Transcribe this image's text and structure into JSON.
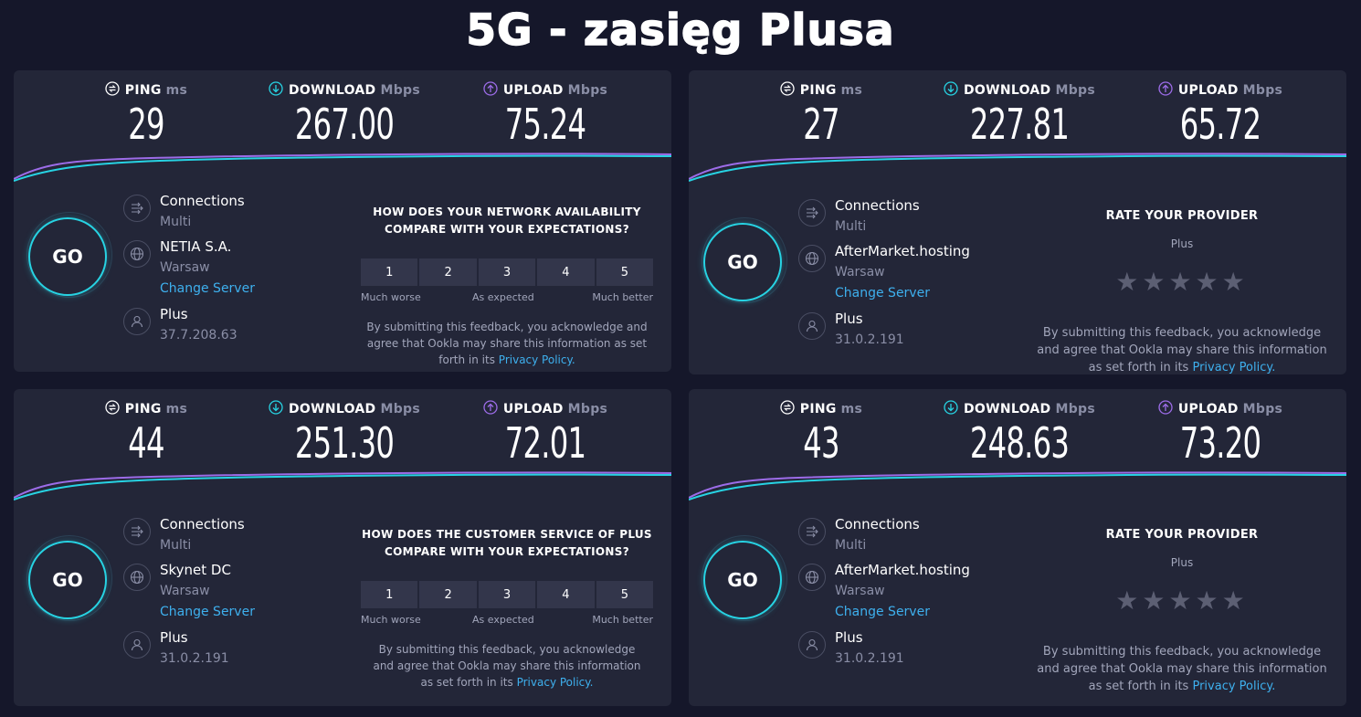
{
  "title": "5G - zasięg Plusa",
  "colors": {
    "download_accent": "#27d3e3",
    "upload_accent": "#9c6ce8",
    "link": "#3eb0ee"
  },
  "labels": {
    "ping": "PING",
    "ping_unit": "ms",
    "download": "DOWNLOAD",
    "download_unit": "Mbps",
    "upload": "UPLOAD",
    "upload_unit": "Mbps",
    "go": "GO",
    "connections": "Connections",
    "change_server": "Change Server",
    "privacy_policy": "Privacy Policy."
  },
  "panels": [
    {
      "ping": "29",
      "download": "267.00",
      "upload": "75.24",
      "connections_mode": "Multi",
      "server_name": "NETIA S.A.",
      "server_city": "Warsaw",
      "provider": "Plus",
      "ip": "37.7.208.63",
      "feedback": {
        "question_line1": "HOW DOES YOUR NETWORK AVAILABILITY",
        "question_line2": "COMPARE WITH YOUR EXPECTATIONS?",
        "scale": [
          "1",
          "2",
          "3",
          "4",
          "5"
        ],
        "low": "Much worse",
        "mid": "As expected",
        "high": "Much better",
        "note_line1": "By submitting this feedback, you acknowledge and",
        "note_line2": "agree that Ookla may share this information as set",
        "note_line3": "forth in its"
      }
    },
    {
      "ping": "27",
      "download": "227.81",
      "upload": "65.72",
      "connections_mode": "Multi",
      "server_name": "AfterMarket.hosting",
      "server_city": "Warsaw",
      "provider": "Plus",
      "ip": "31.0.2.191",
      "rate": {
        "title": "RATE YOUR PROVIDER",
        "provider": "Plus",
        "stars": 5,
        "rating": 0,
        "note_line1": "By submitting this feedback, you acknowledge",
        "note_line2": "and agree that Ookla may share this information",
        "note_line3": "as set forth in its"
      }
    },
    {
      "ping": "44",
      "download": "251.30",
      "upload": "72.01",
      "connections_mode": "Multi",
      "server_name": "Skynet DC",
      "server_city": "Warsaw",
      "provider": "Plus",
      "ip": "31.0.2.191",
      "feedback": {
        "question_line1": "HOW DOES THE CUSTOMER SERVICE OF PLUS",
        "question_line2": "COMPARE WITH YOUR EXPECTATIONS?",
        "scale": [
          "1",
          "2",
          "3",
          "4",
          "5"
        ],
        "low": "Much worse",
        "mid": "As expected",
        "high": "Much better",
        "note_line1": "By submitting this feedback, you acknowledge",
        "note_line2": "and agree that Ookla may share this information",
        "note_line3": "as set forth in its"
      }
    },
    {
      "ping": "43",
      "download": "248.63",
      "upload": "73.20",
      "connections_mode": "Multi",
      "server_name": "AfterMarket.hosting",
      "server_city": "Warsaw",
      "provider": "Plus",
      "ip": "31.0.2.191",
      "rate": {
        "title": "RATE YOUR PROVIDER",
        "provider": "Plus",
        "stars": 5,
        "rating": 0,
        "note_line1": "By submitting this feedback, you acknowledge",
        "note_line2": "and agree that Ookla may share this information",
        "note_line3": "as set forth in its"
      }
    }
  ]
}
